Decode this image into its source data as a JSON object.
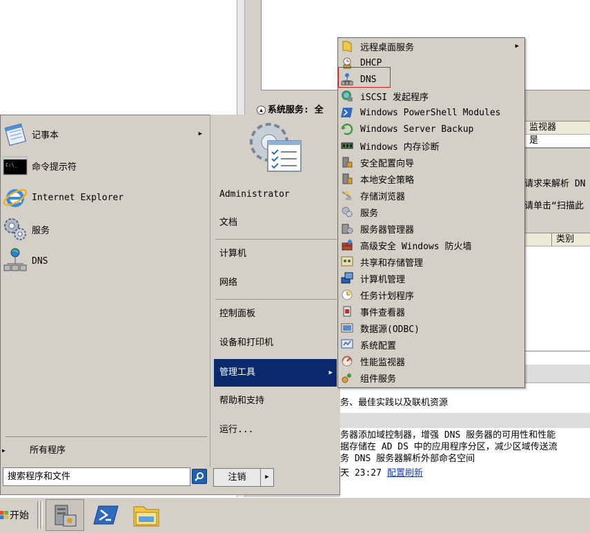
{
  "background_window": {
    "system_services": "系统服务: 全",
    "table_headers": [
      "监视器"
    ],
    "table_values": [
      "是"
    ],
    "text1": "请求来解析 DN",
    "text2": "请单击“扫描此",
    "category_header": "类别",
    "best_practices": "务、最佳实践以及联机资源",
    "description_lines": [
      "务器添加域控制器，增强 DNS 服务器的可用性和性能",
      "据存储在 AD DS 中的应用程序分区，减少区域传送流",
      "务 DNS 服务器解析外部命名空间"
    ],
    "refresh_time": "天 23:27",
    "refresh_link": "配置刷新"
  },
  "start_menu": {
    "pinned": [
      {
        "label": "记事本",
        "icon": "notepad-icon",
        "has_submenu": true
      },
      {
        "label": "命令提示符",
        "icon": "cmd-icon",
        "has_submenu": false
      },
      {
        "label": "Internet Explorer",
        "icon": "ie-icon",
        "has_submenu": false
      },
      {
        "label": "服务",
        "icon": "services-icon",
        "has_submenu": false
      },
      {
        "label": "DNS",
        "icon": "dns-icon",
        "has_submenu": false
      }
    ],
    "all_programs": "所有程序",
    "search_placeholder": "搜索程序和文件",
    "right_items": [
      {
        "label": "Administrator"
      },
      {
        "label": "文档"
      },
      {
        "label": "计算机"
      },
      {
        "label": "网络"
      },
      {
        "label": "控制面板"
      },
      {
        "label": "设备和打印机"
      },
      {
        "label": "管理工具",
        "selected": true
      },
      {
        "label": "帮助和支持"
      },
      {
        "label": "运行..."
      }
    ],
    "logoff": "注销"
  },
  "admin_tools_menu": {
    "items": [
      {
        "label": "远程桌面服务",
        "icon": "folder-icon",
        "has_submenu": true
      },
      {
        "label": "DHCP",
        "icon": "dhcp-icon"
      },
      {
        "label": "DNS",
        "icon": "dns-icon",
        "highlighted": true
      },
      {
        "label": "iSCSI 发起程序",
        "icon": "iscsi-icon"
      },
      {
        "label": "Windows PowerShell Modules",
        "icon": "powershell-icon"
      },
      {
        "label": "Windows Server Backup",
        "icon": "backup-icon"
      },
      {
        "label": "Windows 内存诊断",
        "icon": "memory-icon"
      },
      {
        "label": "安全配置向导",
        "icon": "security-wizard-icon"
      },
      {
        "label": "本地安全策略",
        "icon": "local-policy-icon"
      },
      {
        "label": "存储浏览器",
        "icon": "storage-explorer-icon"
      },
      {
        "label": "服务",
        "icon": "services-icon"
      },
      {
        "label": "服务器管理器",
        "icon": "server-manager-icon"
      },
      {
        "label": "高级安全 Windows 防火墙",
        "icon": "firewall-icon"
      },
      {
        "label": "共享和存储管理",
        "icon": "share-storage-icon"
      },
      {
        "label": "计算机管理",
        "icon": "computer-management-icon"
      },
      {
        "label": "任务计划程序",
        "icon": "task-scheduler-icon"
      },
      {
        "label": "事件查看器",
        "icon": "event-viewer-icon"
      },
      {
        "label": "数据源(ODBC)",
        "icon": "odbc-icon"
      },
      {
        "label": "系统配置",
        "icon": "msconfig-icon"
      },
      {
        "label": "性能监视器",
        "icon": "perfmon-icon"
      },
      {
        "label": "组件服务",
        "icon": "component-services-icon"
      }
    ]
  },
  "taskbar": {
    "start_label": "开始",
    "apps": [
      {
        "icon": "server-manager-icon",
        "active": true
      },
      {
        "icon": "powershell-icon"
      },
      {
        "icon": "explorer-folder-icon"
      }
    ]
  },
  "colors": {
    "menu_bg": "#d4d0c8",
    "selection": "#0b2a6e",
    "dns_highlight_border": "#e02020",
    "link": "#1a3cb4"
  }
}
